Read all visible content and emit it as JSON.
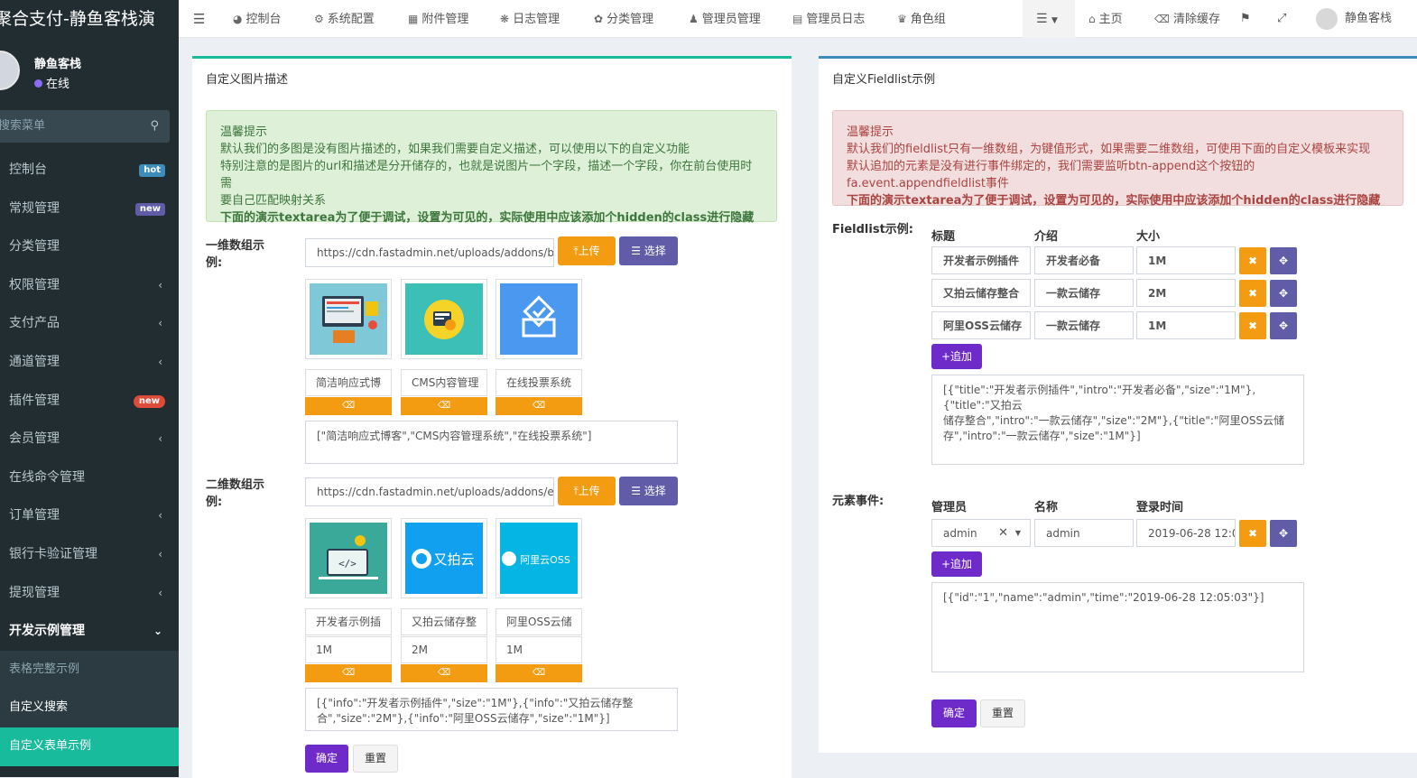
{
  "sidebar": {
    "logo": "聚合支付-静鱼客栈演",
    "user_name": "静鱼客栈",
    "user_status": "在线",
    "search_placeholder": "搜索菜单",
    "items": [
      {
        "label": "控制台",
        "badge": "hot"
      },
      {
        "label": "常规管理",
        "badge": "new"
      },
      {
        "label": "分类管理"
      },
      {
        "label": "权限管理",
        "arrow": "‹"
      },
      {
        "label": "支付产品",
        "arrow": "‹"
      },
      {
        "label": "通道管理",
        "arrow": "‹"
      },
      {
        "label": "插件管理",
        "badge": "new"
      },
      {
        "label": "会员管理",
        "arrow": "‹"
      },
      {
        "label": "在线命令管理"
      },
      {
        "label": "订单管理",
        "arrow": "‹"
      },
      {
        "label": "银行卡验证管理",
        "arrow": "‹"
      },
      {
        "label": "提现管理",
        "arrow": "‹"
      },
      {
        "label": "开发示例管理",
        "arrow": "⌄"
      }
    ],
    "sub_items": [
      "表格完整示例",
      "自定义搜索",
      "自定义表单示例"
    ]
  },
  "navbar": {
    "items": [
      "控制台",
      "系统配置",
      "附件管理",
      "日志管理",
      "分类管理",
      "管理员管理",
      "管理员日志",
      "角色组"
    ],
    "home": "主页",
    "clear_cache": "清除缓存",
    "user": "静鱼客栈"
  },
  "left": {
    "title": "自定义图片描述",
    "alert": {
      "title": "温馨提示",
      "line1": "默认我们的多图是没有图片描述的，如果我们需要自定义描述，可以使用以下的自定义功能",
      "line2": "特别注意的是图片的url和描述是分开储存的，也就是说图片一个字段，描述一个字段，你在前台使用时需",
      "line3": "要自己匹配映射关系",
      "line4": "下面的演示textarea为了便于调试，设置为可见的，实际使用中应该添加个hidden的class进行隐藏"
    },
    "one_dim_label": "一维数组示",
    "one_dim_label2": "例:",
    "one_dim_url": "https://cdn.fastadmin.net/uploads/addons/blog.p",
    "upload_label": "上传",
    "choose_label": "选择",
    "one_dim_captions": [
      "简洁响应式博",
      "CMS内容管理",
      "在线投票系统"
    ],
    "one_dim_json": "[\"简洁响应式博客\",\"CMS内容管理系统\",\"在线投票系统\"]",
    "two_dim_label": "二维数组示",
    "two_dim_label2": "例:",
    "two_dim_url": "https://cdn.fastadmin.net/uploads/addons/examp",
    "two_dim_titles": [
      "开发者示例插",
      "又拍云储存整",
      "阿里OSS云储"
    ],
    "two_dim_sizes": [
      "1M",
      "2M",
      "1M"
    ],
    "two_dim_json1": "[{\"info\":\"开发者示例插件\",\"size\":\"1M\"},{\"info\":\"又拍云储存整",
    "two_dim_json2": "合\",\"size\":\"2M\"},{\"info\":\"阿里OSS云储存\",\"size\":\"1M\"}]",
    "thumb_upyun": "又拍云",
    "thumb_aliyun": "阿里云OSS",
    "confirm": "确定",
    "reset": "重置"
  },
  "right": {
    "title": "自定义Fieldlist示例",
    "alert": {
      "title": "温馨提示",
      "line1": "默认我们的fieldlist只有一维数组，为键值形式，如果需要二维数组，可使用下面的自定义模板来实现",
      "line2": "默认追加的元素是没有进行事件绑定的，我们需要监听btn-append这个按钮的fa.event.appendfieldlist事件",
      "line3": "下面的演示textarea为了便于调试，设置为可见的，实际使用中应该添加个hidden的class进行隐藏"
    },
    "fieldlist_label": "Fieldlist示例:",
    "headers": [
      "标题",
      "介绍",
      "大小"
    ],
    "rows": [
      [
        "开发者示例插件",
        "一款云储存",
        "1M"
      ],
      [
        "又拍云储存整合",
        "一款云储存",
        "2M"
      ],
      [
        "阿里OSS云储存",
        "一款云储存",
        "1M"
      ]
    ],
    "row1_intro_fix": "开发者必备",
    "append": "追加",
    "fieldlist_json1": "[{\"title\":\"开发者示例插件\",\"intro\":\"开发者必备\",\"size\":\"1M\"},{\"title\":\"又拍云",
    "fieldlist_json2": "储存整合\",\"intro\":\"一款云储存\",\"size\":\"2M\"},{\"title\":\"阿里OSS云储",
    "fieldlist_json3": "存\",\"intro\":\"一款云储存\",\"size\":\"1M\"}]",
    "event_label": "元素事件:",
    "event_headers": [
      "管理员",
      "名称",
      "登录时间"
    ],
    "event_row": {
      "admin_select": "admin",
      "name": "admin",
      "time": "2019-06-28 12:0"
    },
    "event_json": "[{\"id\":\"1\",\"name\":\"admin\",\"time\":\"2019-06-28 12:05:03\"}]",
    "confirm": "确定",
    "reset": "重置"
  },
  "colors": {
    "sidebar": "#222d32",
    "active": "#18bc9c",
    "orange": "#f39c12",
    "indigo": "#605ca8",
    "purple": "#6f2bc9"
  }
}
